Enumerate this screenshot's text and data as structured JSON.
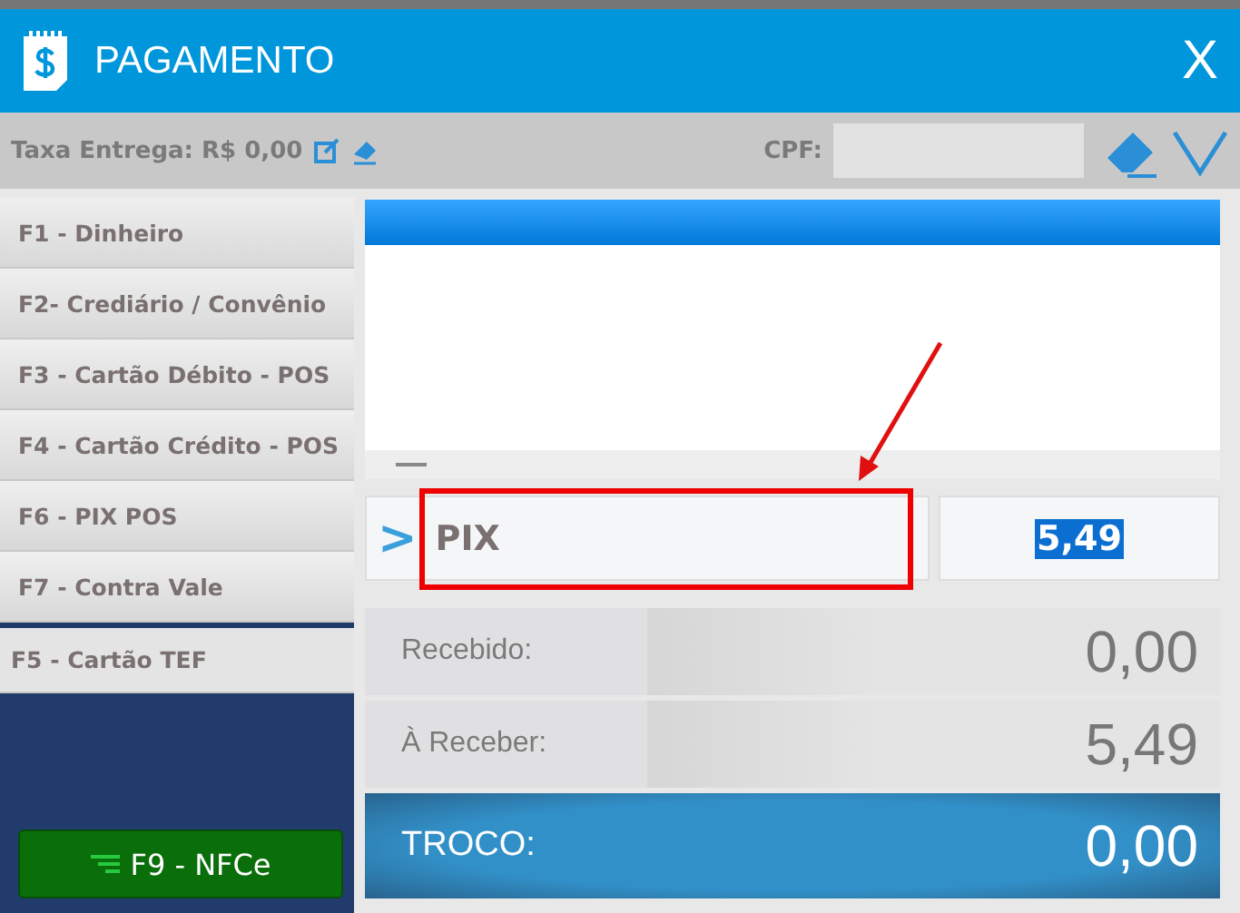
{
  "window": {
    "title": "PAGAMENTO",
    "close": "X"
  },
  "toolbar": {
    "delivery_fee": "Taxa Entrega: R$ 0,00",
    "cpf_label": "CPF:"
  },
  "methods": [
    {
      "label": "F1 - Dinheiro"
    },
    {
      "label": "F2- Crediário / Convênio"
    },
    {
      "label": "F3 - Cartão Débito - POS"
    },
    {
      "label": "F4 - Cartão Crédito - POS"
    },
    {
      "label": "F6 - PIX POS"
    },
    {
      "label": "F7 - Contra Vale"
    },
    {
      "label": "F5 - Cartão TEF"
    }
  ],
  "finish_button": "F9 - NFCe",
  "entry": {
    "prompt": ">",
    "method": "PIX",
    "amount": "5,49"
  },
  "totals": [
    {
      "label": "Recebido:",
      "value": "0,00",
      "kind": "plain"
    },
    {
      "label": "À Receber:",
      "value": "5,49",
      "kind": "plain"
    },
    {
      "label": "TROCO:",
      "value": "0,00",
      "kind": "change"
    }
  ]
}
